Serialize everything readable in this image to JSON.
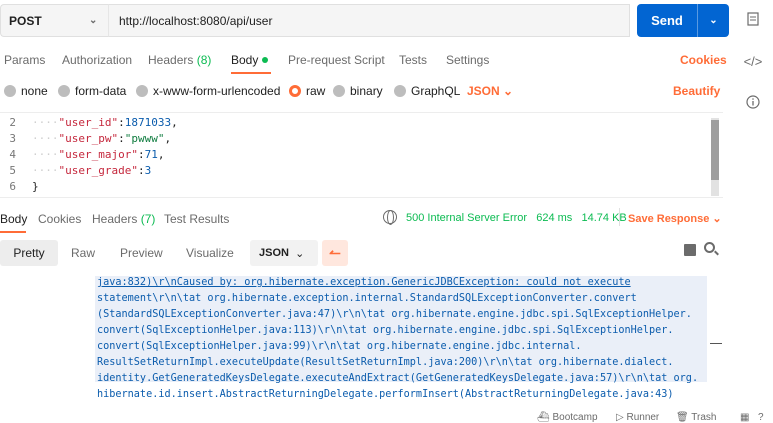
{
  "request": {
    "method": "POST",
    "url": "http://localhost:8080/api/user",
    "send_label": "Send"
  },
  "request_tabs": [
    {
      "label": "Params"
    },
    {
      "label": "Authorization"
    },
    {
      "label": "Headers",
      "count": "(8)"
    },
    {
      "label": "Body",
      "active": true
    },
    {
      "label": "Pre-request Script"
    },
    {
      "label": "Tests"
    },
    {
      "label": "Settings"
    }
  ],
  "cookies_label": "Cookies",
  "body_types": [
    {
      "label": "none"
    },
    {
      "label": "form-data"
    },
    {
      "label": "x-www-form-urlencoded"
    },
    {
      "label": "raw",
      "selected": true
    },
    {
      "label": "binary"
    },
    {
      "label": "GraphQL"
    }
  ],
  "body_format": "JSON",
  "beautify_label": "Beautify",
  "editor": {
    "lines": [
      {
        "num": "2",
        "key": "\"user_id\"",
        "value": "1871033",
        "kind": "num",
        "comma": true
      },
      {
        "num": "3",
        "key": "\"user_pw\"",
        "value": "\"pwww\"",
        "kind": "str",
        "comma": true
      },
      {
        "num": "4",
        "key": "\"user_major\"",
        "value": "71",
        "kind": "num",
        "comma": true
      },
      {
        "num": "5",
        "key": "\"user_grade\"",
        "value": "3",
        "kind": "num",
        "comma": false
      },
      {
        "num": "6",
        "key": "",
        "value": "}",
        "kind": "plain",
        "comma": false
      }
    ]
  },
  "response": {
    "tabs": [
      {
        "label": "Body",
        "active": true
      },
      {
        "label": "Cookies"
      },
      {
        "label": "Headers",
        "count": "(7)"
      },
      {
        "label": "Test Results"
      }
    ],
    "status": "500 Internal Server Error",
    "time": "624 ms",
    "size": "14.74 KB",
    "save_label": "Save Response",
    "view_tabs": [
      "Pretty",
      "Raw",
      "Preview",
      "Visualize"
    ],
    "format": "JSON",
    "lines": [
      "java:832)\\r\\nCaused by: org.hibernate.exception.GenericJDBCException: could not execute",
      "statement\\r\\n\\tat org.hibernate.exception.internal.StandardSQLExceptionConverter.convert",
      "(StandardSQLExceptionConverter.java:47)\\r\\n\\tat org.hibernate.engine.jdbc.spi.SqlExceptionHelper.",
      "convert(SqlExceptionHelper.java:113)\\r\\n\\tat org.hibernate.engine.jdbc.spi.SqlExceptionHelper.",
      "convert(SqlExceptionHelper.java:99)\\r\\n\\tat org.hibernate.engine.jdbc.internal.",
      "ResultSetReturnImpl.executeUpdate(ResultSetReturnImpl.java:200)\\r\\n\\tat org.hibernate.dialect.",
      "identity.GetGeneratedKeysDelegate.executeAndExtract(GetGeneratedKeysDelegate.java:57)\\r\\n\\tat org.",
      "hibernate.id.insert.AbstractReturningDelegate.performInsert(AbstractReturningDelegate.java:43)"
    ]
  },
  "footer": {
    "bootcamp": "Bootcamp",
    "runner": "Runner",
    "trash": "Trash"
  },
  "colors": {
    "accent": "#ff6c37",
    "send": "#0265d2",
    "success": "#0cbb52"
  }
}
